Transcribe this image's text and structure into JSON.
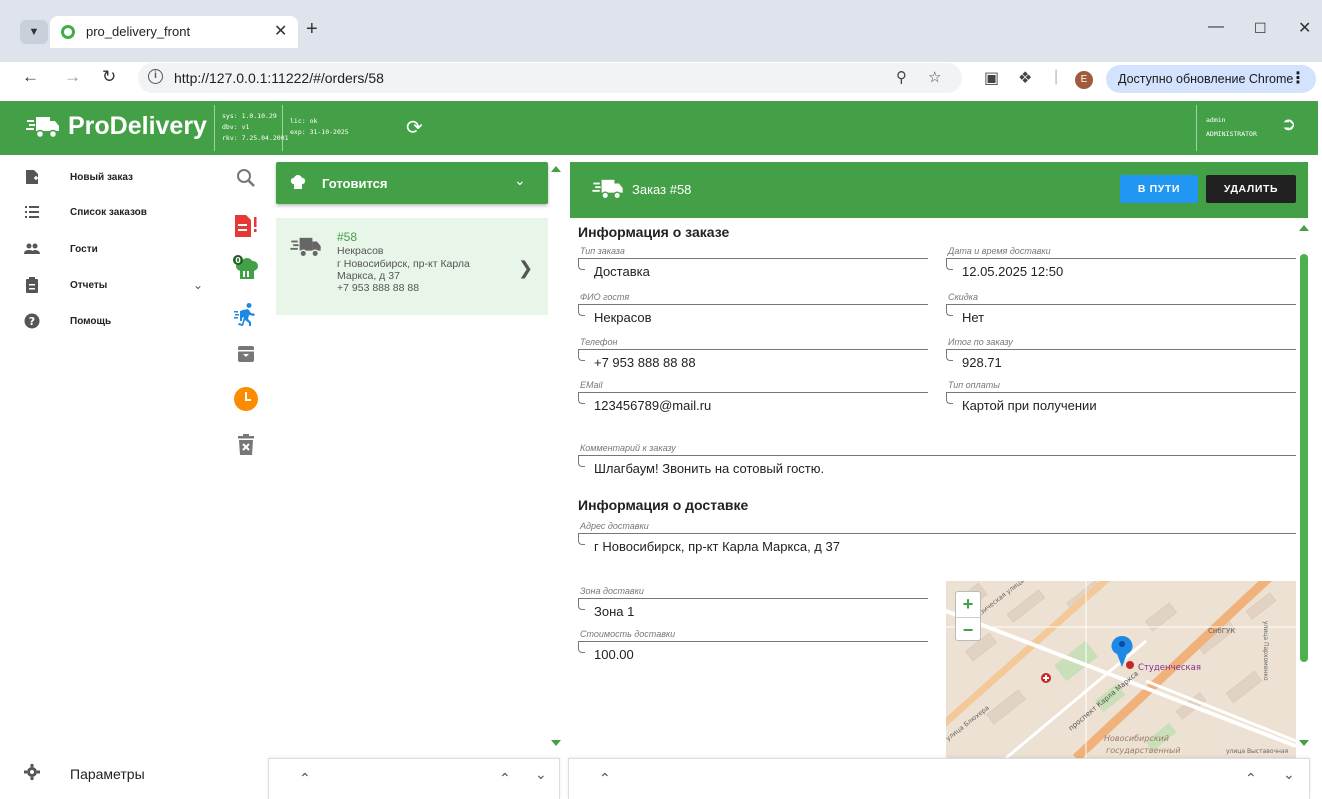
{
  "browser": {
    "tab_title": "pro_delivery_front",
    "url": "http://127.0.0.1:11222/#/orders/58",
    "profile_initial": "E",
    "update_text": "Доступно обновление Chrome"
  },
  "header": {
    "brand": "ProDelivery",
    "sys": "sys: 1.0.10.29",
    "dbv": "dbv: v1",
    "rkv": "rkv: 7.25.04.2001",
    "lic": "lic: ok",
    "exp": "exp: 31-10-2025",
    "user": "admin",
    "role": "ADMINISTRATOR"
  },
  "nav": {
    "items": [
      {
        "label": "Новый заказ",
        "icon": "new-order-icon"
      },
      {
        "label": "Список заказов",
        "icon": "list-icon"
      },
      {
        "label": "Гости",
        "icon": "people-icon"
      },
      {
        "label": "Отчеты",
        "icon": "clipboard-icon"
      },
      {
        "label": "Помощь",
        "icon": "help-icon"
      }
    ],
    "settings_label": "Параметры"
  },
  "tools": {
    "badge_count": "0"
  },
  "orders": {
    "status_filter": "Готовится",
    "card": {
      "number": "#58",
      "name": "Некрасов",
      "address_line1": "г Новосибирск, пр-кт Карла",
      "address_line2": "Маркса, д 37",
      "phone": "+7 953 888 88 88"
    }
  },
  "detail": {
    "title": "Заказ #58",
    "btn_onway": "В ПУТИ",
    "btn_delete": "УДАЛИТЬ",
    "order_info_title": "Информация о заказе",
    "delivery_info_title": "Информация о доставке",
    "fields": {
      "order_type": {
        "label": "Тип заказа",
        "value": "Доставка"
      },
      "delivery_datetime": {
        "label": "Дата и время доставки",
        "value": "12.05.2025 12:50"
      },
      "guest_name": {
        "label": "ФИО гостя",
        "value": "Некрасов"
      },
      "discount": {
        "label": "Скидка",
        "value": "Нет"
      },
      "phone": {
        "label": "Телефон",
        "value": "+7 953 888 88 88"
      },
      "total": {
        "label": "Итог по заказу",
        "value": "928.71"
      },
      "email": {
        "label": "EMail",
        "value": "123456789@mail.ru"
      },
      "payment_type": {
        "label": "Тип оплаты",
        "value": "Картой при получении"
      },
      "comment": {
        "label": "Комментарий к заказу",
        "value": "Шлагбаум! Звонить на сотовый гостю."
      },
      "address": {
        "label": "Адрес доставки",
        "value": "г Новосибирск, пр-кт Карла Маркса, д 37"
      },
      "zone": {
        "label": "Зона доставки",
        "value": "Зона 1"
      },
      "delivery_cost": {
        "label": "Стоимость доставки",
        "value": "100.00"
      }
    },
    "map": {
      "label_station": "Студенческая",
      "label_sibguti": "СибГУК",
      "label_university": "Новосибирский",
      "label_university2": "государственный",
      "label_street1": "Геодезическая улица",
      "label_street2": "проспект Карла Маркса",
      "label_street3": "улица Блюхера",
      "label_street4": "улица Выставочная",
      "label_street5": "улица Пархоменко",
      "zoom_in": "+",
      "zoom_out": "−"
    }
  },
  "colors": {
    "brand_green": "#43a047",
    "button_blue": "#2196f3",
    "button_dark": "#212121",
    "card_bg": "#e8f5e9"
  }
}
